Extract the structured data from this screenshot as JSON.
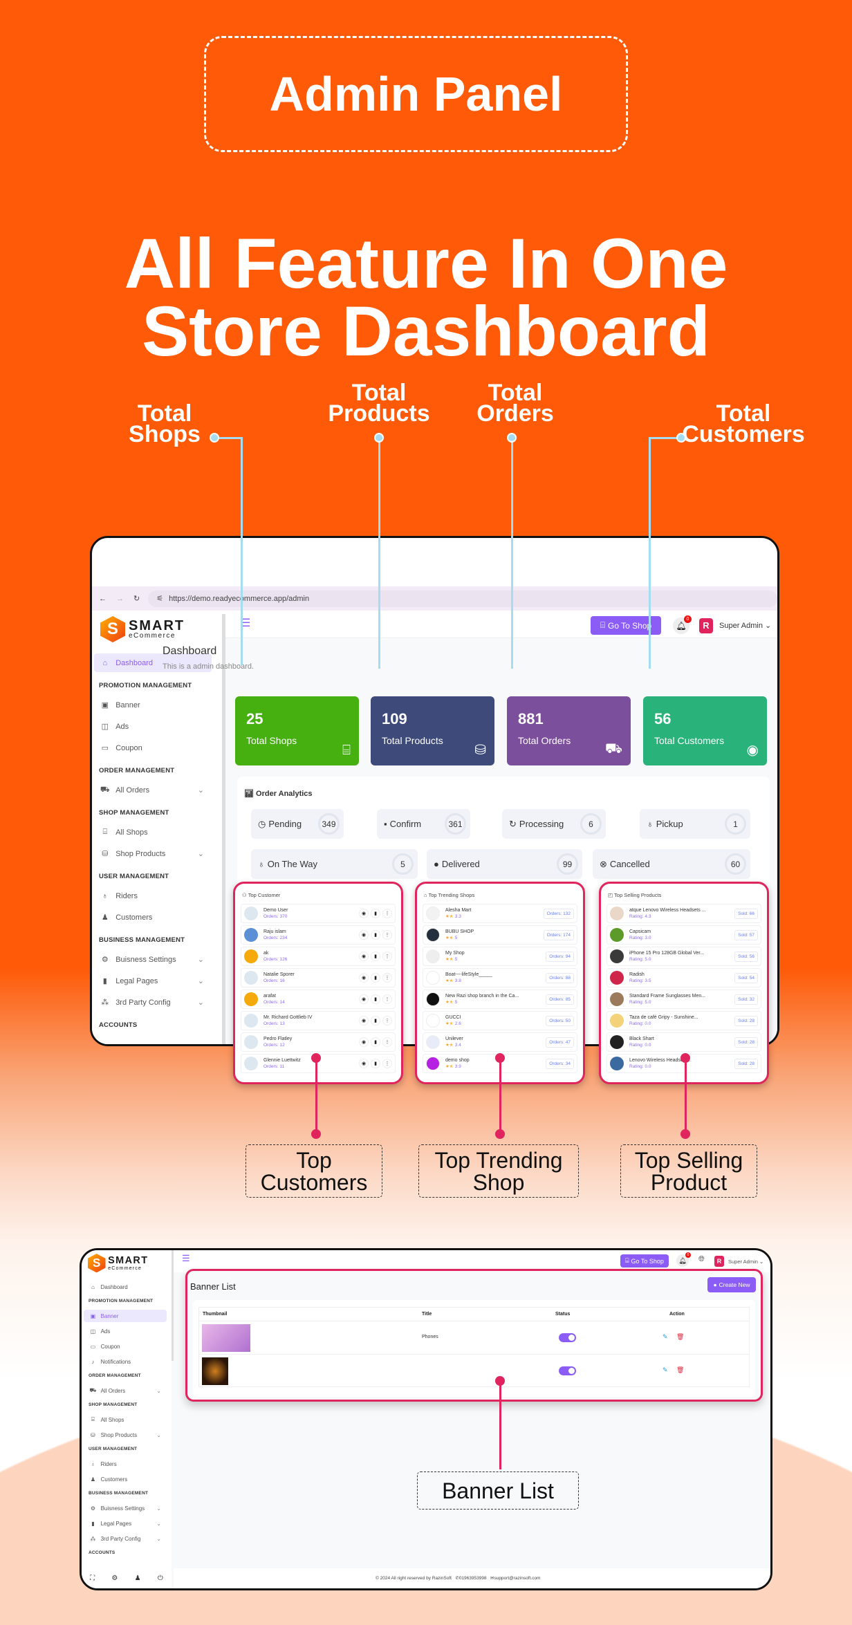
{
  "hero": {
    "badge": "Admin Panel",
    "headline_line1": "All Feature In One",
    "headline_line2": "Store Dashboard"
  },
  "callouts": {
    "total_shops": "Total\nShops",
    "total_products": "Total\nProducts",
    "total_orders": "Total\nOrders",
    "total_customers": "Total\nCustomers",
    "top_customers": "Top\nCustomers",
    "top_trending_shop": "Top Trending\nShop",
    "top_selling_product": "Top Selling\nProduct",
    "banner_list": "Banner List"
  },
  "colors": {
    "background": "#fe5a07",
    "accent": "#8b5cf6",
    "highlight": "#e0245e",
    "callout_line": "#a6dcf2"
  },
  "browser": {
    "url": "https://demo.readyecommerce.app/admin"
  },
  "brand": {
    "name": "SMART",
    "sub": "eCommerce"
  },
  "header": {
    "go_to_shop": "Go To Shop",
    "notifications": "0",
    "user": "Super Admin"
  },
  "sidebar1": [
    {
      "type": "item",
      "label": "Dashboard",
      "icon": "home-icon",
      "glyph": "⌂",
      "active": true
    },
    {
      "type": "section",
      "label": "PROMOTION MANAGEMENT"
    },
    {
      "type": "item",
      "label": "Banner",
      "icon": "image-icon",
      "glyph": "▣"
    },
    {
      "type": "item",
      "label": "Ads",
      "icon": "ads-icon",
      "glyph": "◫"
    },
    {
      "type": "item",
      "label": "Coupon",
      "icon": "coupon-icon",
      "glyph": "▭"
    },
    {
      "type": "section",
      "label": "ORDER MANAGEMENT"
    },
    {
      "type": "item",
      "label": "All Orders",
      "icon": "cart-icon",
      "glyph": "⛟",
      "chev": true
    },
    {
      "type": "section",
      "label": "SHOP MANAGEMENT"
    },
    {
      "type": "item",
      "label": "All Shops",
      "icon": "store-icon",
      "glyph": "⌸"
    },
    {
      "type": "item",
      "label": "Shop Products",
      "icon": "basket-icon",
      "glyph": "⛁",
      "chev": true
    },
    {
      "type": "section",
      "label": "USER MANAGEMENT"
    },
    {
      "type": "item",
      "label": "Riders",
      "icon": "bike-icon",
      "glyph": "♁"
    },
    {
      "type": "item",
      "label": "Customers",
      "icon": "user-icon",
      "glyph": "♟"
    },
    {
      "type": "section",
      "label": "BUSINESS MANAGEMENT"
    },
    {
      "type": "item",
      "label": "Buisness Settings",
      "icon": "gear-icon",
      "glyph": "⚙",
      "chev": true
    },
    {
      "type": "item",
      "label": "Legal Pages",
      "icon": "bookmark-icon",
      "glyph": "▮",
      "chev": true
    },
    {
      "type": "item",
      "label": "3rd Party Config",
      "icon": "network-icon",
      "glyph": "⁂",
      "chev": true
    },
    {
      "type": "section",
      "label": "ACCOUNTS"
    }
  ],
  "sidebar2": [
    {
      "type": "item",
      "label": "Dashboard",
      "icon": "home-icon",
      "glyph": "⌂"
    },
    {
      "type": "section",
      "label": "PROMOTION MANAGEMENT"
    },
    {
      "type": "item",
      "label": "Banner",
      "icon": "image-icon",
      "glyph": "▣",
      "active": true
    },
    {
      "type": "item",
      "label": "Ads",
      "icon": "ads-icon",
      "glyph": "◫"
    },
    {
      "type": "item",
      "label": "Coupon",
      "icon": "coupon-icon",
      "glyph": "▭"
    },
    {
      "type": "item",
      "label": "Notifications",
      "icon": "bell-icon",
      "glyph": "♪"
    },
    {
      "type": "section",
      "label": "ORDER MANAGEMENT"
    },
    {
      "type": "item",
      "label": "All Orders",
      "icon": "cart-icon",
      "glyph": "⛟",
      "chev": true
    },
    {
      "type": "section",
      "label": "SHOP MANAGEMENT"
    },
    {
      "type": "item",
      "label": "All Shops",
      "icon": "store-icon",
      "glyph": "⌸"
    },
    {
      "type": "item",
      "label": "Shop Products",
      "icon": "basket-icon",
      "glyph": "⛁",
      "chev": true
    },
    {
      "type": "section",
      "label": "USER MANAGEMENT"
    },
    {
      "type": "item",
      "label": "Riders",
      "icon": "bike-icon",
      "glyph": "♁"
    },
    {
      "type": "item",
      "label": "Customers",
      "icon": "user-icon",
      "glyph": "♟"
    },
    {
      "type": "section",
      "label": "BUSINESS MANAGEMENT"
    },
    {
      "type": "item",
      "label": "Buisness Settings",
      "icon": "gear-icon",
      "glyph": "⚙",
      "chev": true
    },
    {
      "type": "item",
      "label": "Legal Pages",
      "icon": "bookmark-icon",
      "glyph": "▮",
      "chev": true
    },
    {
      "type": "item",
      "label": "3rd Party Config",
      "icon": "network-icon",
      "glyph": "⁂",
      "chev": true
    },
    {
      "type": "section",
      "label": "ACCOUNTS"
    }
  ],
  "dashboard": {
    "title": "Dashboard",
    "subtitle": "This is a admin dashboard.",
    "stats": [
      {
        "value": "25",
        "label": "Total Shops",
        "color": "#45b010",
        "icon": "store-icon",
        "glyph": "⌸"
      },
      {
        "value": "109",
        "label": "Total Products",
        "color": "#3d4a7a",
        "icon": "basket-icon",
        "glyph": "⛁"
      },
      {
        "value": "881",
        "label": "Total Orders",
        "color": "#7b4f9b",
        "icon": "cart-icon",
        "glyph": "⛟"
      },
      {
        "value": "56",
        "label": "Total Customers",
        "color": "#2ab27b",
        "icon": "user-circle-icon",
        "glyph": "◉"
      }
    ],
    "order_analytics": {
      "title": "Order Analytics",
      "items": [
        {
          "label": "Pending",
          "count": "349",
          "icon": "clock-icon",
          "glyph": "◷"
        },
        {
          "label": "Confirm",
          "count": "361",
          "icon": "bag-check-icon",
          "glyph": "▪"
        },
        {
          "label": "Processing",
          "count": "6",
          "icon": "refresh-icon",
          "glyph": "↻"
        },
        {
          "label": "Pickup",
          "count": "1",
          "icon": "bike-icon",
          "glyph": "♁"
        },
        {
          "label": "On The Way",
          "count": "5",
          "icon": "bike-icon",
          "glyph": "♁"
        },
        {
          "label": "Delivered",
          "count": "99",
          "icon": "badge-check-icon",
          "glyph": "●"
        },
        {
          "label": "Cancelled",
          "count": "60",
          "icon": "x-circle-icon",
          "glyph": "⊗"
        }
      ]
    }
  },
  "top_customers": {
    "title": "Top Customer",
    "items": [
      {
        "name": "Demo User",
        "sub": "Orders: 370",
        "color": "#dde7f0"
      },
      {
        "name": "Raju islam",
        "sub": "Orders: 234",
        "color": "#5b8fd6"
      },
      {
        "name": "ak",
        "sub": "Orders: 126",
        "color": "#f5a90a"
      },
      {
        "name": "Natalie Sporer",
        "sub": "Orders: 16",
        "color": "#dde7f0"
      },
      {
        "name": "arafat",
        "sub": "Orders: 14",
        "color": "#f5a90a"
      },
      {
        "name": "Mr. Richard Gottlieb IV",
        "sub": "Orders: 13",
        "color": "#dde7f0"
      },
      {
        "name": "Pedro Flatley",
        "sub": "Orders: 12",
        "color": "#dde7f0"
      },
      {
        "name": "Glennie Luettwitz",
        "sub": "Orders: 11",
        "color": "#dde7f0"
      }
    ]
  },
  "top_shops": {
    "title": "Top Trending Shops",
    "items": [
      {
        "name": "Alesha Mart",
        "rating": "3.3",
        "orders": "Orders: 132",
        "color": "#f2f2f2"
      },
      {
        "name": "BUBU SHOP",
        "rating": "5",
        "orders": "Orders: 174",
        "color": "#232f3e"
      },
      {
        "name": "My Shop",
        "rating": "5",
        "orders": "Orders: 94",
        "color": "#eeeeee"
      },
      {
        "name": "Boat----lifeStyle_____",
        "rating": "3.8",
        "orders": "Orders: 88",
        "color": "#ffffff"
      },
      {
        "name": "New Razi shop branch in the Ca...",
        "rating": "5",
        "orders": "Orders: 85",
        "color": "#111111"
      },
      {
        "name": "GUCCI",
        "rating": "2.6",
        "orders": "Orders: 50",
        "color": "#ffffff"
      },
      {
        "name": "Unilever",
        "rating": "3.4",
        "orders": "Orders: 47",
        "color": "#e8ecf8"
      },
      {
        "name": "demo shop",
        "rating": "3.9",
        "orders": "Orders: 34",
        "color": "#b620e0"
      }
    ]
  },
  "top_products": {
    "title": "Top Selling Products",
    "items": [
      {
        "name": "atque Lenovo Wireless Headsets ...",
        "sub": "Rating: 4.3",
        "sold": "Sold: 66",
        "color": "#e9d8c8"
      },
      {
        "name": "Capsicam",
        "sub": "Rating: 3.0",
        "sold": "Sold: 57",
        "color": "#5c9a2a"
      },
      {
        "name": "iPhone 15 Pro 128GB Global Ver...",
        "sub": "Rating: 5.0",
        "sold": "Sold: 56",
        "color": "#3a3a3a"
      },
      {
        "name": "Radish",
        "sub": "Rating: 3.5",
        "sold": "Sold: 54",
        "color": "#d0254a"
      },
      {
        "name": "Standard Frame Sunglasses Men...",
        "sub": "Rating: 5.0",
        "sold": "Sold: 32",
        "color": "#9a7a5a"
      },
      {
        "name": "Taza de café Gripy - Sunshine...",
        "sub": "Rating: 0.0",
        "sold": "Sold: 28",
        "color": "#f3d27a"
      },
      {
        "name": "Black Shart",
        "sub": "Rating: 0.0",
        "sold": "Sold: 28",
        "color": "#222222"
      },
      {
        "name": "Lenovo Wireless Headsets...",
        "sub": "Rating: 0.0",
        "sold": "Sold: 28",
        "color": "#3b6aa0"
      }
    ]
  },
  "banner_page": {
    "title": "Banner List",
    "create": "Create New",
    "columns": [
      "Thumbnail",
      "Title",
      "Status",
      "Action"
    ],
    "rows": [
      {
        "title": "Phones",
        "status": true
      },
      {
        "title": "",
        "status": true
      }
    ]
  },
  "footer": {
    "copyright": "© 2024 All right reserved by RazinSoft",
    "phone": "01963953998",
    "email": "support@razinsoft.com"
  }
}
